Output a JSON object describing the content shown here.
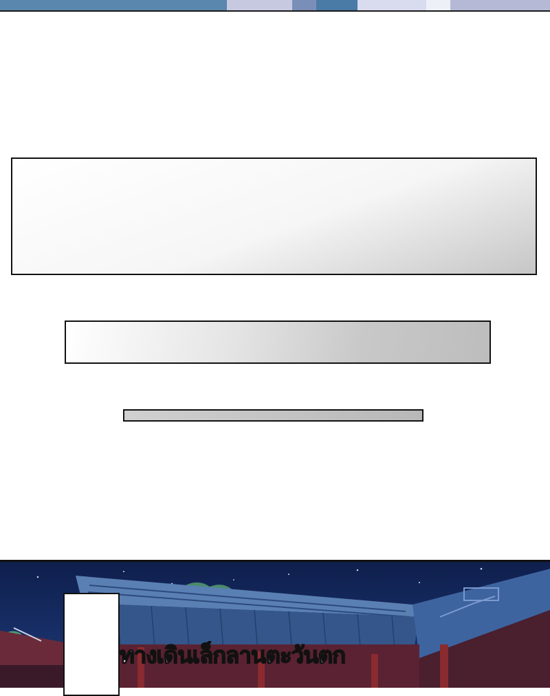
{
  "caption": {
    "text": "ทางเดินเล็กลานตะวันตก"
  },
  "colors": {
    "night_sky": "#14285e",
    "roof": "#3a5a8c",
    "pillar_red": "#8a2b2f",
    "panel_border": "#111111"
  }
}
